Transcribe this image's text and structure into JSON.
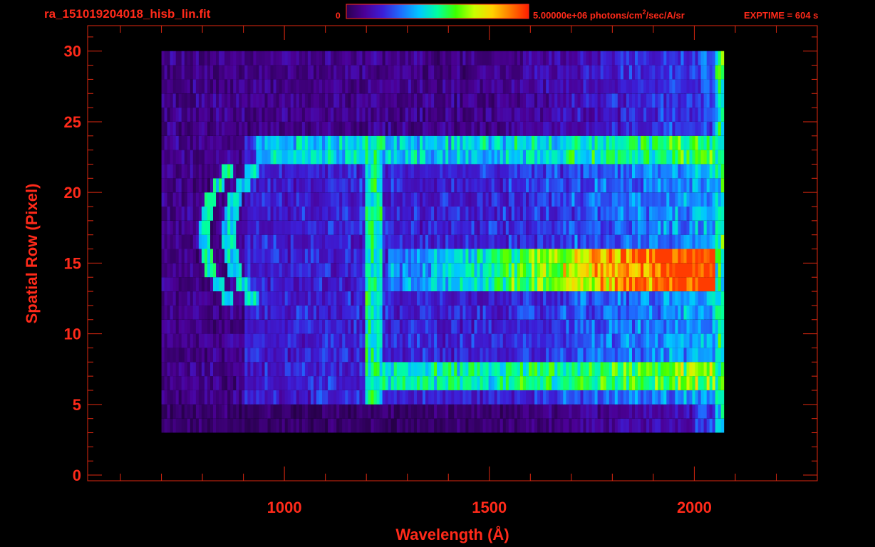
{
  "header": {
    "filename": "ra_151019204018_hisb_lin.fit",
    "colorbar_min_label": "0",
    "colorbar_max_prefix": "5.00000e+06 photons/cm",
    "colorbar_max_sup": "2",
    "colorbar_max_suffix": "/sec/A/sr",
    "exptime": "EXPTIME = 604 s"
  },
  "colors": {
    "label_red": "#ff2a1a",
    "axis_red": "#e02810",
    "background": "#000000",
    "colormap": [
      "#000000",
      "#2a0050",
      "#4b0096",
      "#3c1ed7",
      "#1e6eff",
      "#00c8ff",
      "#00ffa0",
      "#3cff00",
      "#c8ff00",
      "#ffd200",
      "#ff7800",
      "#ff1e00"
    ]
  },
  "chart_data": {
    "type": "heatmap",
    "title": "ra_151019204018_hisb_lin.fit",
    "xlabel": "Wavelength (Å)",
    "ylabel": "Spatial Row (Pixel)",
    "xlim": [
      520,
      2300
    ],
    "ylim": [
      -0.4,
      31.8
    ],
    "x_ticks": [
      1000,
      1500,
      2000
    ],
    "x_tick_labels": [
      "1000",
      "1500",
      "2000"
    ],
    "y_ticks": [
      0,
      5,
      10,
      15,
      20,
      25,
      30
    ],
    "y_tick_labels": [
      "0",
      "5",
      "10",
      "15",
      "20",
      "25",
      "30"
    ],
    "colorbar": {
      "min": 0,
      "max": 5000000,
      "units": "photons/cm^2/sec/A/sr"
    },
    "data_extent_x": [
      700,
      2070
    ],
    "rows": 31,
    "features": {
      "lyman_alpha_center": 1216,
      "bright_band_rows": [
        13,
        15
      ],
      "bright_band_peak_wavelength": 1980,
      "lower_band_rows": [
        6,
        8
      ],
      "upper_band_rows": [
        22,
        24
      ],
      "low_row_limit": 3,
      "high_row_limit": 30
    },
    "legend": "colorbar top",
    "grid": false
  }
}
